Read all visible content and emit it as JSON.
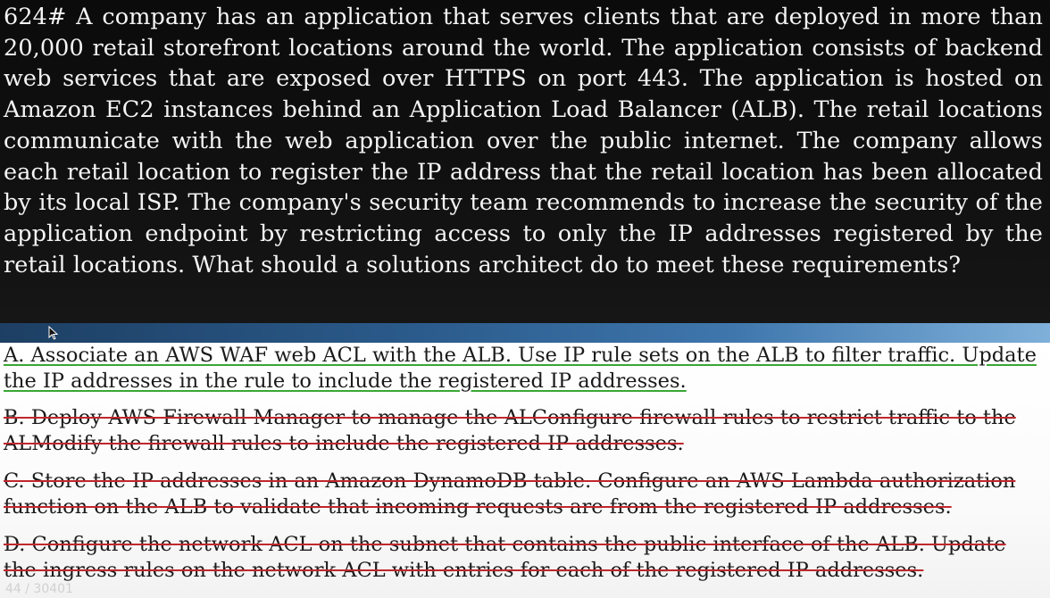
{
  "question": {
    "text": "624# A company has an application that serves clients that are deployed in more than 20,000 retail storefront locations around the world. The application consists of backend web services that are exposed over HTTPS on port 443. The application is hosted on Amazon EC2 instances behind an Application Load Balancer (ALB). The retail locations communicate with the web application over the public internet. The company allows each retail location to register the IP address that the retail location has been allocated by its local ISP. The company's security team recommends to increase the security of the application endpoint by restricting access to only the IP addresses registered by the retail locations. What should a solutions architect do to meet these requirements?"
  },
  "options": {
    "a": {
      "line1": "A. Associate an AWS WAF web ACL with the ALB. Use IP rule sets on the ALB to filter traffic. Update",
      "line2": "the IP addresses in the rule to include the registered IP addresses.",
      "status": "correct",
      "mark_color": "#3aa635"
    },
    "b": {
      "line1": "B. Deploy AWS Firewall Manager to manage the ALConfigure firewall rules to restrict traffic to the",
      "line2": "ALModify the firewall rules to include the registered IP addresses.",
      "status": "incorrect",
      "mark_color": "#c0272d"
    },
    "c": {
      "line1": "C. Store the IP addresses in an Amazon DynamoDB table. Configure an AWS Lambda authorization",
      "line2": "function on the ALB to validate that incoming requests are from the registered IP addresses.",
      "status": "incorrect",
      "mark_color": "#c0272d"
    },
    "d": {
      "line1": "D. Configure the network ACL on the subnet that contains the public interface of the ALB. Update",
      "line2": "the ingress rules on the network ACL with entries for each of the registered IP addresses.",
      "status": "incorrect",
      "mark_color": "#c0272d"
    }
  },
  "footer": {
    "watermark": "44 / 30401"
  },
  "colors": {
    "question_bg": "#0b0b0b",
    "question_text": "#f4f4f4",
    "divider_accent": "#2b5b8c",
    "answer_bg": "#ffffff"
  }
}
